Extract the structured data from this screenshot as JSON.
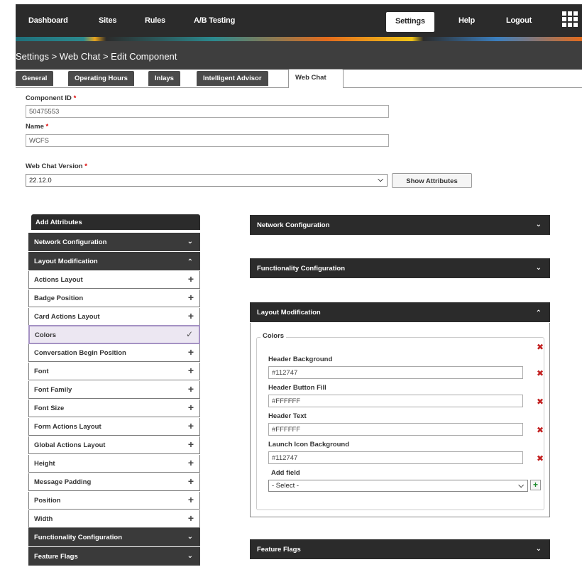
{
  "nav": {
    "items": [
      "Dashboard",
      "Sites",
      "Rules",
      "A/B Testing"
    ],
    "settings": "Settings",
    "help": "Help",
    "logout": "Logout"
  },
  "breadcrumb": "Settings > Web Chat > Edit Component",
  "tabs": [
    "General",
    "Operating Hours",
    "Inlays",
    "Intelligent Advisor",
    "Web Chat"
  ],
  "active_tab": "Web Chat",
  "form": {
    "component_id_label": "Component ID",
    "component_id_value": "50475553",
    "name_label": "Name",
    "name_value": "WCFS",
    "version_label": "Web Chat Version",
    "version_value": "22.12.0",
    "required_mark": "*",
    "show_attributes": "Show Attributes"
  },
  "left_panel": {
    "title": "Add Attributes",
    "network_configuration": "Network Configuration",
    "layout_modification": "Layout Modification",
    "items": [
      "Actions Layout",
      "Badge Position",
      "Card Actions Layout",
      "Colors",
      "Conversation Begin Position",
      "Font",
      "Font Family",
      "Font Size",
      "Form Actions Layout",
      "Global Actions Layout",
      "Height",
      "Message Padding",
      "Position",
      "Width"
    ],
    "selected": "Colors",
    "functionality_configuration": "Functionality Configuration",
    "feature_flags": "Feature Flags"
  },
  "right_panel": {
    "network_configuration": "Network Configuration",
    "functionality_configuration": "Functionality Configuration",
    "layout_modification": "Layout Modification",
    "colors_legend": "Colors",
    "fields": [
      {
        "label": "Header Background",
        "value": "#112747"
      },
      {
        "label": "Header Button Fill",
        "value": "#FFFFFF"
      },
      {
        "label": "Header Text",
        "value": "#FFFFFF"
      },
      {
        "label": "Launch Icon Background",
        "value": "#112747"
      }
    ],
    "add_field_label": "Add field",
    "add_field_value": "- Select -",
    "feature_flags": "Feature Flags"
  },
  "colors": {
    "nav_bg": "#2b2b2b",
    "header_bg": "#3e3e3e",
    "remove_red": "#c21f1f",
    "add_green": "#1a8a2a",
    "selected_bg": "#ece7f2"
  }
}
